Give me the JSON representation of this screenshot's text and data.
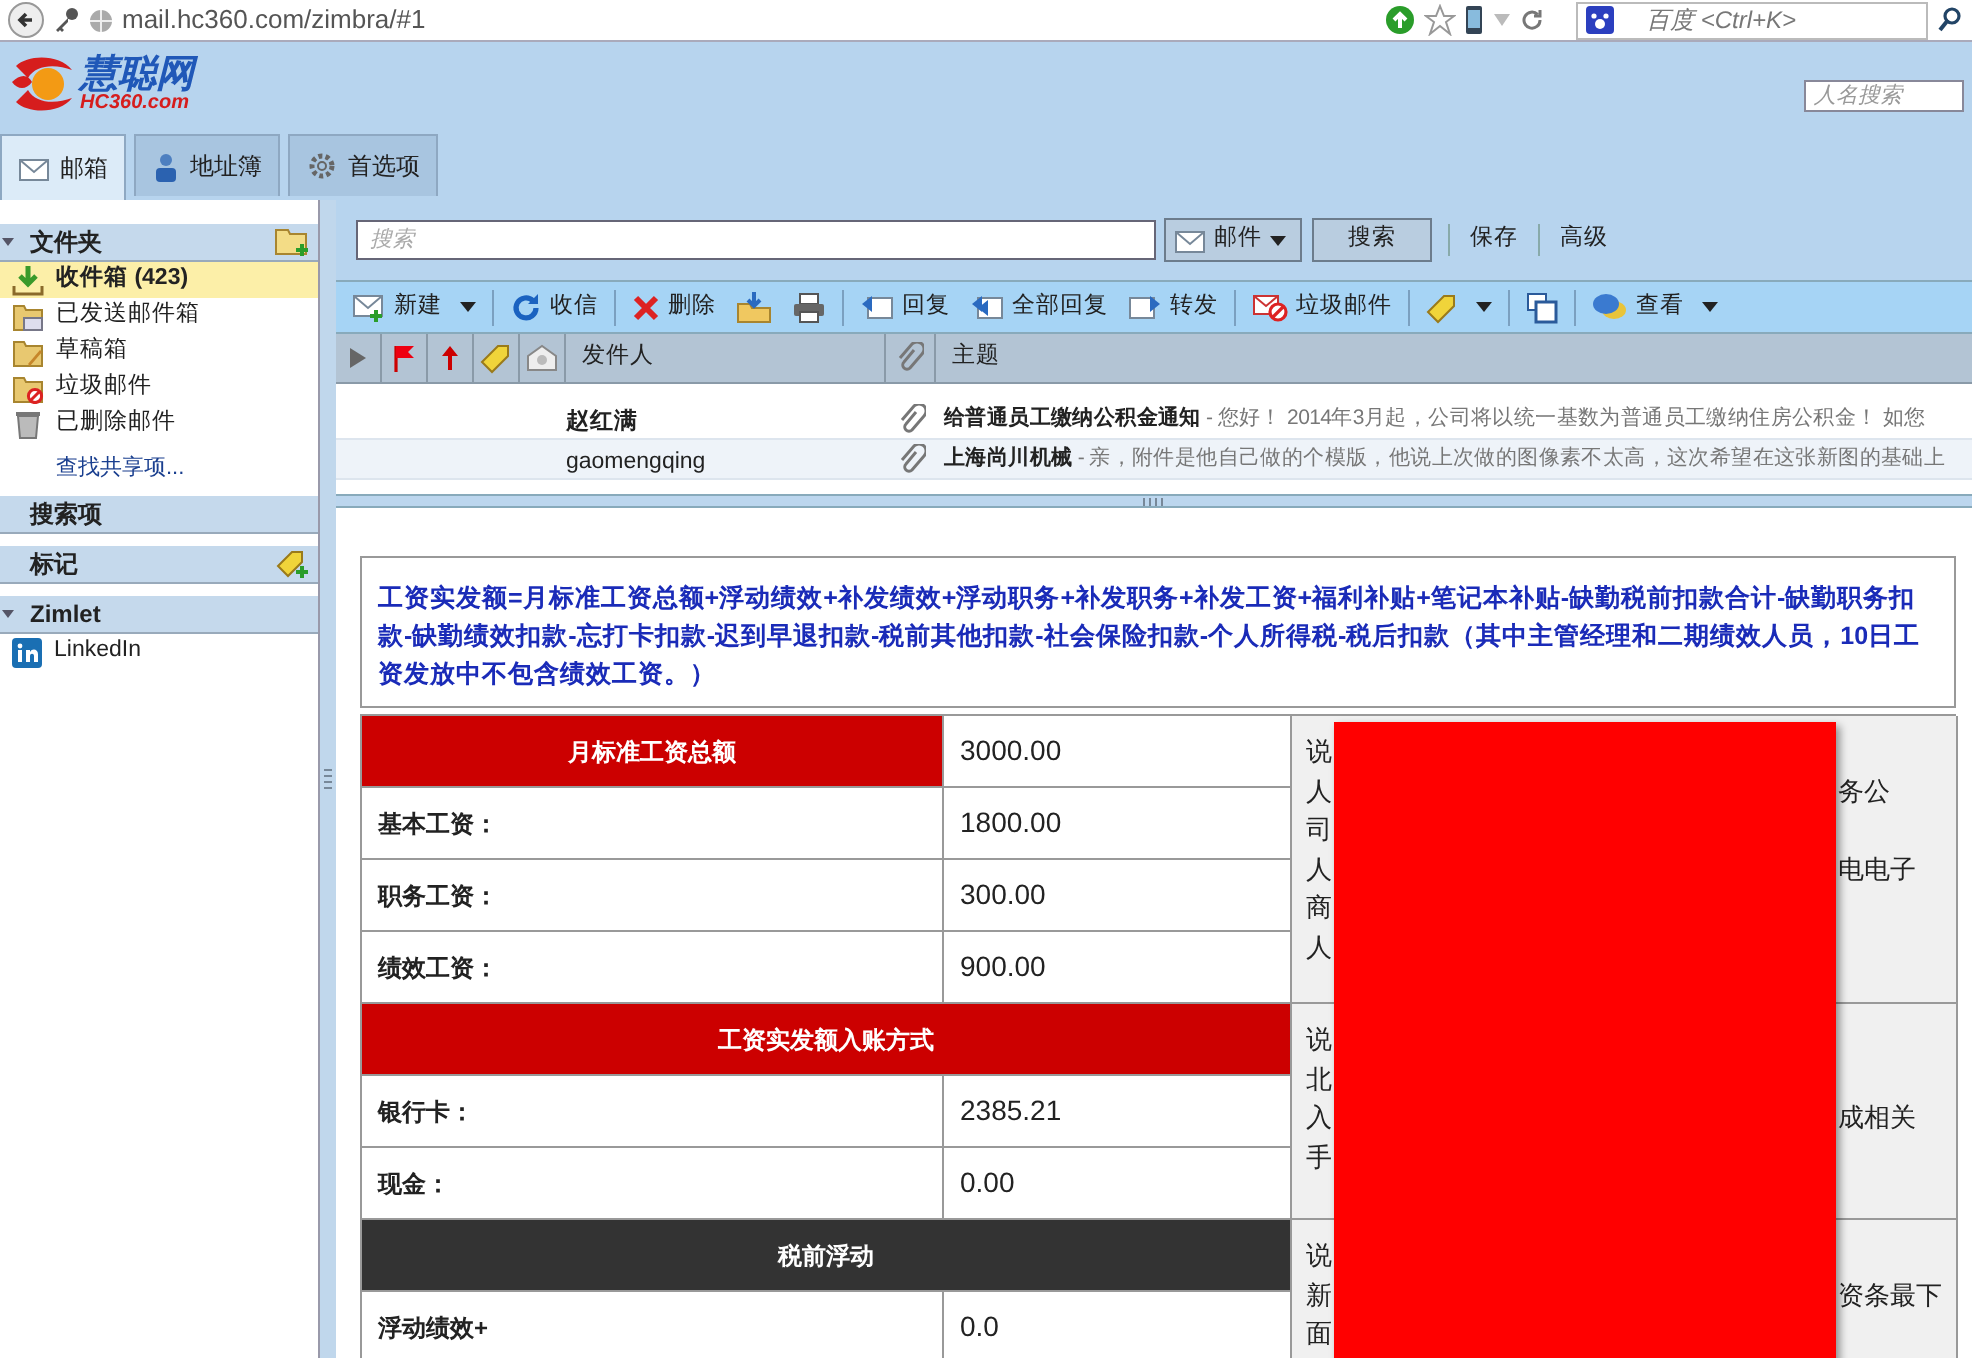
{
  "browser": {
    "url": "mail.hc360.com/zimbra/#1",
    "search_placeholder": "百度 <Ctrl+K>"
  },
  "app": {
    "logo_name": "慧聪网",
    "logo_sub": "HC360.com",
    "people_search_placeholder": "人名搜索",
    "tabs": [
      {
        "label": "邮箱",
        "selected": true
      },
      {
        "label": "地址簿",
        "selected": false
      },
      {
        "label": "首选项",
        "selected": false
      }
    ]
  },
  "sidebar": {
    "sections": [
      {
        "title": "文件夹",
        "expanded": true,
        "items": [
          {
            "label": "收件箱 (423)",
            "selected": true,
            "unread": true
          },
          {
            "label": "已发送邮件箱",
            "selected": false,
            "unread": false
          },
          {
            "label": "草稿箱",
            "selected": false,
            "unread": false
          },
          {
            "label": "垃圾邮件",
            "selected": false,
            "unread": false
          },
          {
            "label": "已删除邮件",
            "selected": false,
            "unread": false
          }
        ],
        "link": "查找共享项..."
      },
      {
        "title": "搜索项",
        "expanded": false
      },
      {
        "title": "标记",
        "expanded": false
      },
      {
        "title": "Zimlet",
        "expanded": true,
        "items": [
          {
            "label": "LinkedIn",
            "selected": false,
            "unread": false
          }
        ]
      }
    ]
  },
  "search": {
    "placeholder": "搜索",
    "scope": "邮件",
    "button": "搜索",
    "links": [
      "保存",
      "高级"
    ]
  },
  "toolbar": [
    [
      {
        "label": "新建",
        "dropdown": true
      }
    ],
    [
      {
        "label": "收信",
        "dropdown": false
      }
    ],
    [
      {
        "label": "删除",
        "dropdown": false
      },
      {
        "dropdown": false
      },
      {
        "dropdown": false
      }
    ],
    [
      {
        "label": "回复",
        "dropdown": false
      },
      {
        "label": "全部回复",
        "dropdown": false
      },
      {
        "label": "转发",
        "dropdown": false
      }
    ],
    [
      {
        "label": "垃圾邮件",
        "dropdown": false
      }
    ],
    [
      {
        "dropdown": true
      }
    ],
    [
      {
        "dropdown": false
      }
    ],
    [
      {
        "label": "查看",
        "dropdown": true
      }
    ]
  ],
  "message_list": {
    "columns": [
      "发件人",
      "主题"
    ],
    "rows": [
      {
        "sender": "赵红满",
        "unread": true,
        "attachment": true,
        "subject": "给普通员工缴纳公积金通知",
        "preview": " - 您好！ 2014年3月起，公司将以统一基数为普通员工缴纳住房公积金！ 如您"
      },
      {
        "sender": "gaomengqing",
        "unread": false,
        "attachment": true,
        "subject": "上海尚川机械",
        "preview": " - 亲，附件是他自己做的个模版，他说上次做的图像素不太高，这次希望在这张新图的基础上"
      }
    ]
  },
  "salary": {
    "formula": "工资实发额=月标准工资总额+浮动绩效+补发绩效+浮动职务+补发职务+补发工资+福利补贴+笔记本补贴-缺勤税前扣款合计-缺勤职务扣款-缺勤绩效扣款-忘打卡扣款-迟到早退扣款-税前其他扣款-社会保险扣款-个人所得税-税后扣款（其中主管经理和二期绩效人员，10日工资发放中不包含绩效工资。）",
    "redacted": true,
    "rows": [
      {
        "kind": "header",
        "color": "#cc0000",
        "label": "月标准工资总额",
        "value": "3000.00"
      },
      {
        "kind": "item",
        "label": "基本工资：",
        "value": "1800.00"
      },
      {
        "kind": "item",
        "label": "职务工资：",
        "value": "300.00"
      },
      {
        "kind": "item",
        "label": "绩效工资：",
        "value": "900.00"
      },
      {
        "kind": "section",
        "color": "#cc0000",
        "label": "工资实发额入账方式"
      },
      {
        "kind": "item",
        "label": "银行卡：",
        "value": "2385.21"
      },
      {
        "kind": "item",
        "label": "现金：",
        "value": "0.00"
      },
      {
        "kind": "section",
        "color": "#333333",
        "label": "税前浮动"
      },
      {
        "kind": "item",
        "label": "浮动绩效+",
        "value": "0.0"
      }
    ],
    "notes": [
      {
        "lines": [
          {
            "left": "说"
          },
          {
            "left": "人",
            "right": "务公"
          },
          {
            "left": "司"
          },
          {
            "left": "人",
            "right": "电电子"
          },
          {
            "left": "商"
          },
          {
            "left": "人"
          }
        ]
      },
      {
        "lines": [
          {
            "left": "说"
          },
          {
            "left": "北"
          },
          {
            "left": "入",
            "right": "成相关"
          },
          {
            "left": "手"
          }
        ]
      },
      {
        "lines": [
          {
            "left": "说"
          },
          {
            "left": "新",
            "right": "资条最下"
          },
          {
            "left": "面"
          }
        ]
      }
    ]
  }
}
